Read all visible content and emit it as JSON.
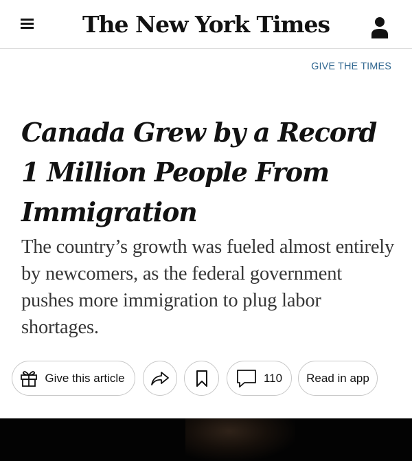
{
  "header": {
    "masthead": "The New York Times",
    "menu_icon": "hamburger-menu-icon",
    "account_icon": "person-icon"
  },
  "promo": {
    "give_link": "GIVE THE TIMES"
  },
  "article": {
    "headline": "Canada Grew by a Record 1 Million People From Immigration",
    "summary": "The country’s growth was fueled almost entirely by newcomers, as the federal government pushes more immigration to plug labor shortages."
  },
  "actions": {
    "gift_label": "Give this article",
    "gift_icon": "gift-icon",
    "share_icon": "share-arrow-icon",
    "save_icon": "bookmark-icon",
    "comment_icon": "comment-icon",
    "comments_count": "110",
    "read_in_app": "Read in app"
  },
  "colors": {
    "link": "#326891",
    "text": "#121212",
    "summary": "#363636",
    "border": "#c7c7c7"
  }
}
